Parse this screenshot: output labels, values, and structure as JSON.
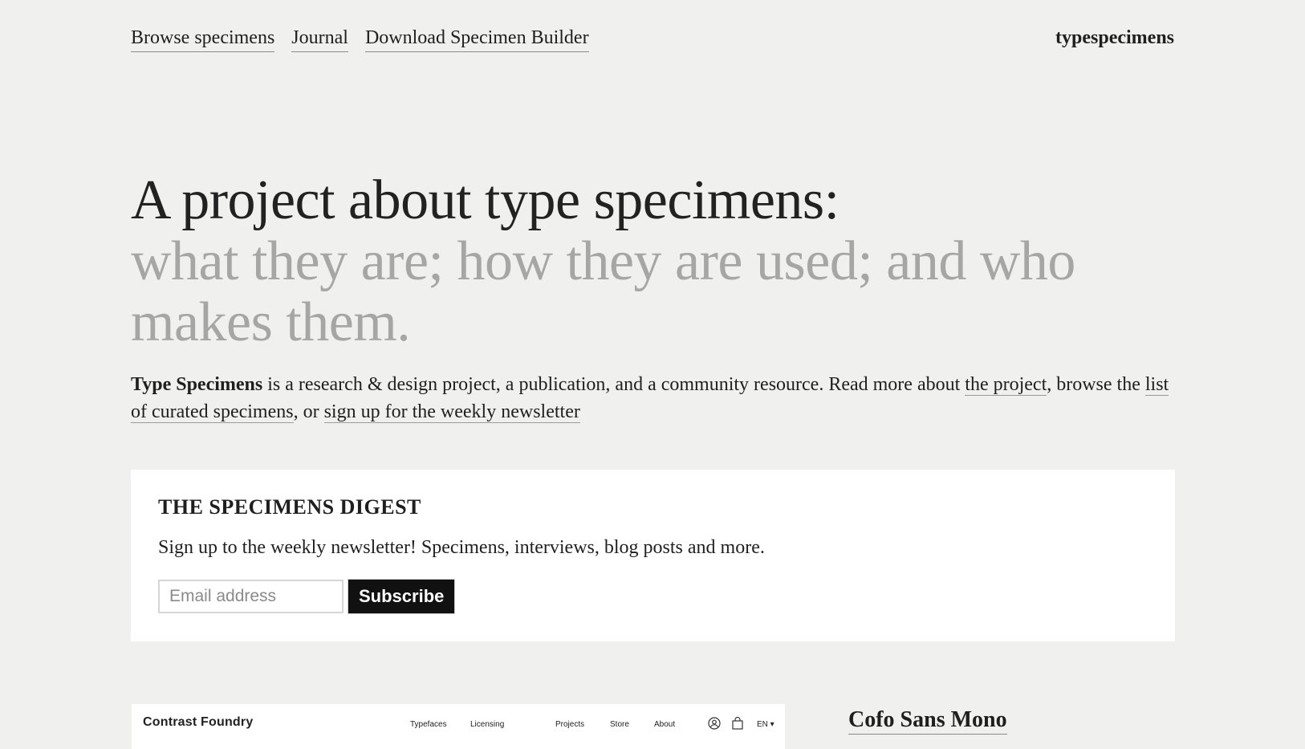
{
  "nav": {
    "links": [
      "Browse specimens",
      "Journal",
      "Download Specimen Builder"
    ],
    "logo": "typespecimens"
  },
  "hero": {
    "line_dark": "A project about type specimens:",
    "line_grey": "what they are; how they are used; and who makes them."
  },
  "intro": {
    "bold": "Type Specimens",
    "text1": " is a research & design project, a publication, and a community resource. Read more about ",
    "link1": "the project",
    "text2": ", browse the ",
    "link2": "list of curated specimens",
    "text3": ", or ",
    "link3": "sign up for the weekly newsletter"
  },
  "digest": {
    "title": "THE SPECIMENS DIGEST",
    "description": "Sign up to the weekly newsletter! Specimens, interviews, blog posts and more.",
    "email_placeholder": "Email address",
    "subscribe_label": "Subscribe"
  },
  "preview": {
    "logo": "Contrast Foundry",
    "nav": [
      "Typefaces",
      "Licensing",
      "Projects",
      "Store",
      "About"
    ],
    "lang": "EN"
  },
  "specimen": {
    "title": "Cofo Sans Mono"
  }
}
